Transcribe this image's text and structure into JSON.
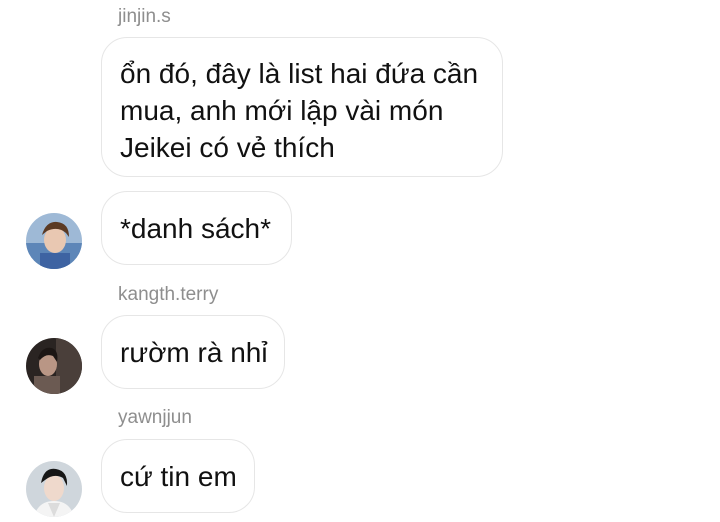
{
  "messages": [
    {
      "sender": "jinjin.s",
      "lines": [
        "ổn đó, đây là list hai đứa cần",
        "mua, anh mới lập vài món",
        "Jeikei có vẻ thích"
      ]
    },
    {
      "sender": "",
      "text": "*danh sách*"
    },
    {
      "sender": "kangth.terry",
      "text": "rườm rà nhỉ"
    },
    {
      "sender": "yawnjjun",
      "text": "cứ tin em"
    }
  ],
  "avatars": {
    "jinjin": "user-avatar-photo",
    "kangth": "user-avatar-photo",
    "yawnjjun": "user-avatar-photo"
  }
}
